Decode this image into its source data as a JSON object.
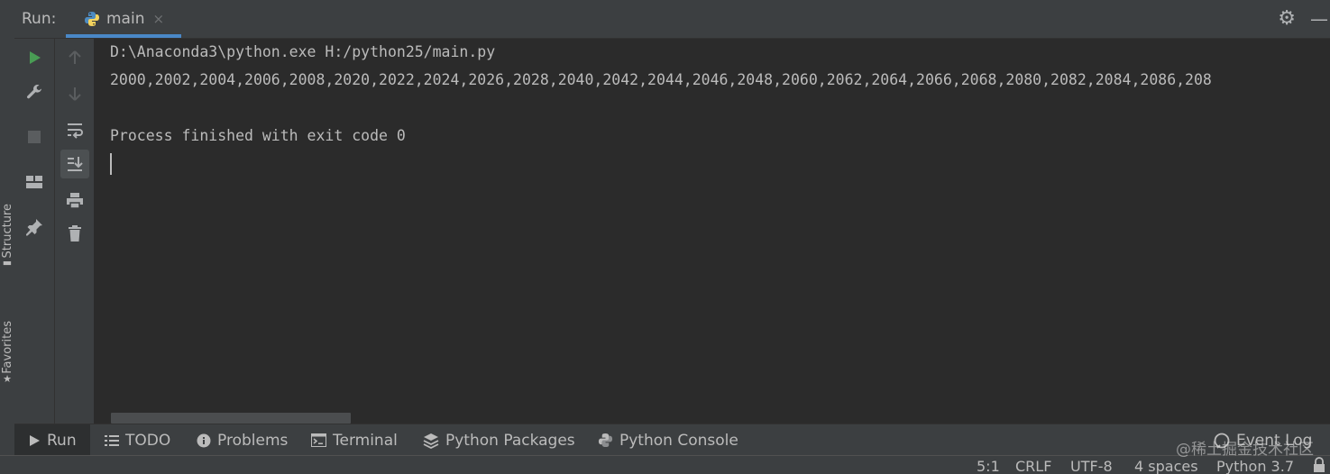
{
  "side_strip": {
    "structure_label": "Structure",
    "favorites_label": "Favorites"
  },
  "header": {
    "run_label": "Run:",
    "tab": {
      "label": "main",
      "close_glyph": "×"
    },
    "settings_icon": "gear-icon",
    "hide_icon": "minimize-icon"
  },
  "toolbar_left": [
    {
      "name": "rerun",
      "icon": "play-icon",
      "color": "#499c54"
    },
    {
      "name": "modify-run-config",
      "icon": "wrench-icon"
    },
    {
      "name": "stop",
      "icon": "stop-icon"
    },
    {
      "name": "restore-layout",
      "icon": "layout-icon"
    },
    {
      "name": "pin-tab",
      "icon": "pin-icon"
    }
  ],
  "toolbar_right": [
    {
      "name": "up-stack-trace",
      "icon": "arrow-up-icon"
    },
    {
      "name": "down-stack-trace",
      "icon": "arrow-down-icon"
    },
    {
      "name": "soft-wrap",
      "icon": "soft-wrap-icon"
    },
    {
      "name": "scroll-to-end",
      "icon": "scroll-to-end-icon",
      "active": true
    },
    {
      "name": "print",
      "icon": "print-icon"
    },
    {
      "name": "clear-all",
      "icon": "trash-icon"
    }
  ],
  "console": {
    "lines": [
      "D:\\Anaconda3\\python.exe H:/python25/main.py",
      "2000,2002,2004,2006,2008,2020,2022,2024,2026,2028,2040,2042,2044,2046,2048,2060,2062,2064,2066,2068,2080,2082,2084,2086,208",
      "",
      "Process finished with exit code 0"
    ]
  },
  "bottom_tabs": [
    {
      "label": "Run",
      "icon": "play-icon",
      "active": true
    },
    {
      "label": "TODO",
      "icon": "list-icon"
    },
    {
      "label": "Problems",
      "icon": "info-icon"
    },
    {
      "label": "Terminal",
      "icon": "terminal-icon"
    },
    {
      "label": "Python Packages",
      "icon": "layers-icon"
    },
    {
      "label": "Python Console",
      "icon": "python-icon"
    }
  ],
  "event_log": {
    "label": "Event Log",
    "icon": "event-log-icon"
  },
  "status_bar": {
    "position": "5:1",
    "line_separator": "CRLF",
    "encoding": "UTF-8",
    "indent": "4 spaces",
    "interpreter": "Python 3.7",
    "lock_icon": "lock-icon"
  },
  "watermark": "@稀土掘金技术社区",
  "colors": {
    "accent": "#4a88c7",
    "run_green": "#499c54",
    "panel_bg": "#3c3f41",
    "editor_bg": "#2b2b2b"
  }
}
